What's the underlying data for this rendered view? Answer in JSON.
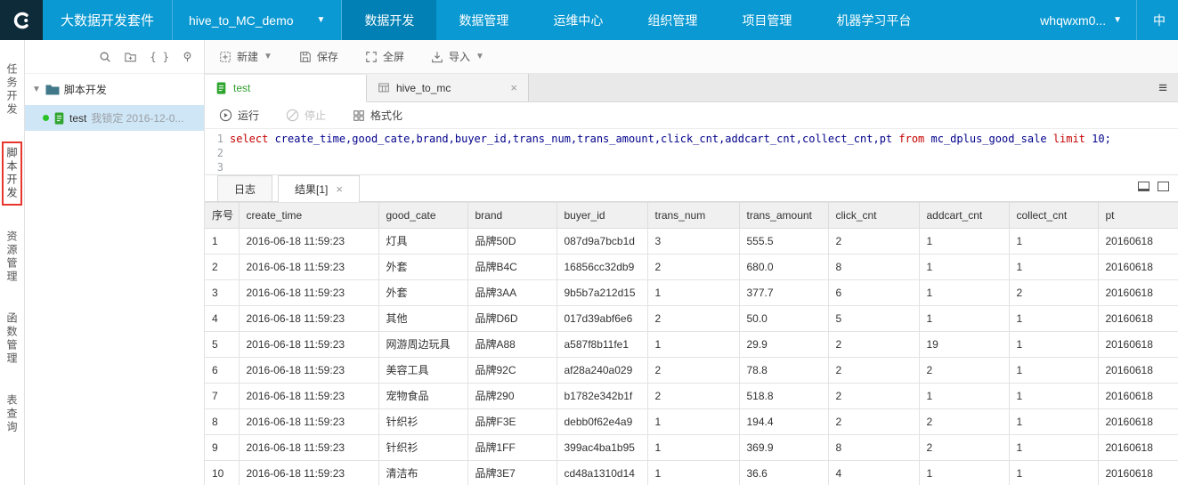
{
  "navbar": {
    "suite_title": "大数据开发套件",
    "project": "hive_to_MC_demo",
    "items": [
      {
        "label": "数据开发",
        "active": true
      },
      {
        "label": "数据管理",
        "active": false
      },
      {
        "label": "运维中心",
        "active": false
      },
      {
        "label": "组织管理",
        "active": false
      },
      {
        "label": "项目管理",
        "active": false
      },
      {
        "label": "机器学习平台",
        "active": false
      }
    ],
    "user": "whqwxm0...",
    "lang": "中"
  },
  "side_rail": {
    "items": [
      {
        "label": "任务开发",
        "active": false
      },
      {
        "label": "脚本开发",
        "active": true
      },
      {
        "label": "资源管理",
        "active": false
      },
      {
        "label": "函数管理",
        "active": false
      },
      {
        "label": "表查询",
        "active": false
      }
    ]
  },
  "tree": {
    "root_label": "脚本开发",
    "item_name": "test",
    "item_lock_info": "我锁定 2016-12-0..."
  },
  "toolbar": {
    "new_label": "新建",
    "save_label": "保存",
    "fullscreen_label": "全屏",
    "import_label": "导入"
  },
  "editor_tabs": [
    {
      "label": "test",
      "active": true
    },
    {
      "label": "hive_to_mc",
      "active": false
    }
  ],
  "run_toolbar": {
    "run_label": "运行",
    "stop_label": "停止",
    "format_label": "格式化"
  },
  "editor": {
    "line_numbers": [
      "1",
      "2",
      "3"
    ],
    "sql_tokens": [
      {
        "text": "select",
        "kw": true
      },
      {
        "text": " create_time,good_cate,brand,buyer_id,trans_num,trans_amount,click_cnt,addcart_cnt,collect_cnt,pt ",
        "kw": false
      },
      {
        "text": "from",
        "kw": true
      },
      {
        "text": " mc_dplus_good_sale ",
        "kw": false
      },
      {
        "text": "limit",
        "kw": true
      },
      {
        "text": " 10;",
        "kw": false
      }
    ]
  },
  "result_panel": {
    "log_tab": "日志",
    "result_tab": "结果[1]"
  },
  "table": {
    "headers": [
      "序号",
      "create_time",
      "good_cate",
      "brand",
      "buyer_id",
      "trans_num",
      "trans_amount",
      "click_cnt",
      "addcart_cnt",
      "collect_cnt",
      "pt"
    ],
    "rows": [
      [
        "1",
        "2016-06-18 11:59:23",
        "灯具",
        "品牌50D",
        "087d9a7bcb1d",
        "3",
        "555.5",
        "2",
        "1",
        "1",
        "20160618"
      ],
      [
        "2",
        "2016-06-18 11:59:23",
        "外套",
        "品牌B4C",
        "16856cc32db9",
        "2",
        "680.0",
        "8",
        "1",
        "1",
        "20160618"
      ],
      [
        "3",
        "2016-06-18 11:59:23",
        "外套",
        "品牌3AA",
        "9b5b7a212d15",
        "1",
        "377.7",
        "6",
        "1",
        "2",
        "20160618"
      ],
      [
        "4",
        "2016-06-18 11:59:23",
        "其他",
        "品牌D6D",
        "017d39abf6e6",
        "2",
        "50.0",
        "5",
        "1",
        "1",
        "20160618"
      ],
      [
        "5",
        "2016-06-18 11:59:23",
        "网游周边玩具",
        "品牌A88",
        "a587f8b11fe1",
        "1",
        "29.9",
        "2",
        "19",
        "1",
        "20160618"
      ],
      [
        "6",
        "2016-06-18 11:59:23",
        "美容工具",
        "品牌92C",
        "af28a240a029",
        "2",
        "78.8",
        "2",
        "2",
        "1",
        "20160618"
      ],
      [
        "7",
        "2016-06-18 11:59:23",
        "宠物食品",
        "品牌290",
        "b1782e342b1f",
        "2",
        "518.8",
        "2",
        "1",
        "1",
        "20160618"
      ],
      [
        "8",
        "2016-06-18 11:59:23",
        "针织衫",
        "品牌F3E",
        "debb0f62e4a9",
        "1",
        "194.4",
        "2",
        "2",
        "1",
        "20160618"
      ],
      [
        "9",
        "2016-06-18 11:59:23",
        "针织衫",
        "品牌1FF",
        "399ac4ba1b95",
        "1",
        "369.9",
        "8",
        "2",
        "1",
        "20160618"
      ],
      [
        "10",
        "2016-06-18 11:59:23",
        "清洁布",
        "品牌3E7",
        "cd48a1310d14",
        "1",
        "36.6",
        "4",
        "1",
        "1",
        "20160618"
      ]
    ]
  },
  "colors": {
    "navbar_blue": "#0a99d2",
    "navbar_active_blue": "#0080b4",
    "accent_green": "#31a031",
    "selection_blue": "#cfe6f6",
    "keyword_red": "#c40000",
    "code_blue": "#00008b",
    "rail_highlight_red": "#e8352e"
  }
}
